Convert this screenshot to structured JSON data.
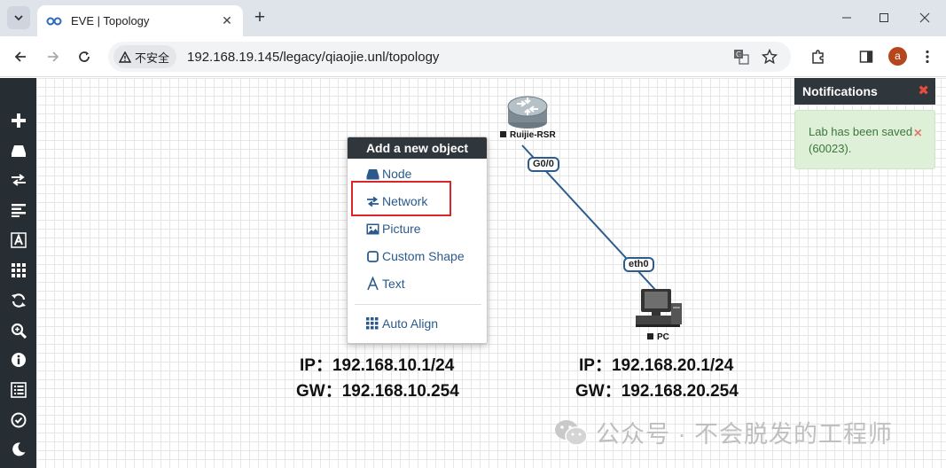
{
  "browser": {
    "tab_title": "EVE | Topology",
    "security_label": "不安全",
    "url": "192.168.19.145/legacy/qiaojie.unl/topology",
    "profile_initial": "a"
  },
  "sidebar": {
    "items": [
      {
        "icon": "plus-icon"
      },
      {
        "icon": "node-icon"
      },
      {
        "icon": "network-icon"
      },
      {
        "icon": "startup-config-icon"
      },
      {
        "icon": "text-icon"
      },
      {
        "icon": "grid-icon"
      },
      {
        "icon": "refresh-icon"
      },
      {
        "icon": "zoom-icon"
      },
      {
        "icon": "info-icon"
      },
      {
        "icon": "list-icon"
      },
      {
        "icon": "check-icon"
      },
      {
        "icon": "moon-icon"
      }
    ]
  },
  "topology": {
    "router_label": "Ruijie-RSR",
    "pc_label": "PC",
    "link": {
      "router_interface": "G0/0",
      "pc_interface": "eth0"
    },
    "router_ip": "IP：192.168.10.1/24",
    "router_gw": "GW：192.168.10.254",
    "pc_ip": "IP：192.168.20.1/24",
    "pc_gw": "GW：192.168.20.254"
  },
  "context_menu": {
    "title": "Add a new object",
    "items": [
      {
        "label": "Node",
        "icon": "node-icon"
      },
      {
        "label": "Network",
        "icon": "network-icon",
        "highlighted": true
      },
      {
        "label": "Picture",
        "icon": "picture-icon"
      },
      {
        "label": "Custom Shape",
        "icon": "shape-icon"
      },
      {
        "label": "Text",
        "icon": "text-icon"
      },
      {
        "label": "Auto Align",
        "icon": "grid-icon"
      }
    ]
  },
  "notifications": {
    "title": "Notifications",
    "message": "Lab has been saved (60023)."
  },
  "watermark": {
    "text": "公众号 · 不会脱发的工程师"
  },
  "colors": {
    "sidebar_bg": "#262d33",
    "header_bg": "#2f363c",
    "link_blue": "#2d5c8c",
    "menu_text": "#2a5a8c",
    "highlight_red": "#d9262b",
    "notif_bg": "#dff0d8",
    "notif_text": "#3c763d"
  }
}
